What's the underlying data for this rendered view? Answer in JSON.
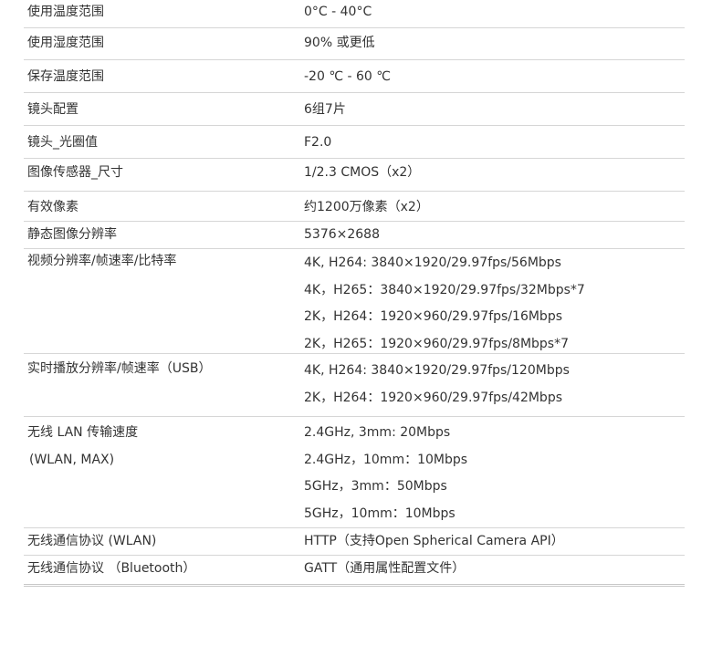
{
  "specs": [
    {
      "label": "使用温度范围",
      "values": [
        "0°C - 40°C"
      ]
    },
    {
      "label": "使用湿度范围",
      "values": [
        "90% 或更低"
      ]
    },
    {
      "label": "保存温度范围",
      "values": [
        "-20 ℃ - 60 ℃"
      ]
    },
    {
      "label": "镜头配置",
      "values": [
        "6组7片"
      ]
    },
    {
      "label": "镜头_光圈值",
      "values": [
        "F2.0"
      ]
    },
    {
      "label": "图像传感器_尺寸",
      "values": [
        "1/2.3 CMOS（x2）"
      ]
    },
    {
      "label": "有效像素",
      "values": [
        "约1200万像素（x2）"
      ]
    },
    {
      "label": "静态图像分辨率",
      "values": [
        "5376×2688"
      ]
    },
    {
      "label": "视频分辨率/帧速率/比特率",
      "values": [
        "4K, H264: 3840×1920/29.97fps/56Mbps",
        "4K，H265：3840×1920/29.97fps/32Mbps*7",
        "2K，H264：1920×960/29.97fps/16Mbps",
        "2K，H265：1920×960/29.97fps/8Mbps*7"
      ]
    },
    {
      "label": "实时播放分辨率/帧速率（USB）",
      "values": [
        "4K, H264: 3840×1920/29.97fps/120Mbps",
        "2K，H264：1920×960/29.97fps/42Mbps"
      ]
    },
    {
      "label": "无线 LAN 传输速度",
      "label2": "(WLAN, MAX)",
      "values": [
        "2.4GHz, 3mm: 20Mbps",
        "2.4GHz，10mm：10Mbps",
        "5GHz，3mm：50Mbps",
        "5GHz，10mm：10Mbps"
      ]
    },
    {
      "label": "无线通信协议 (WLAN)",
      "values": [
        "HTTP（支持Open Spherical Camera API）"
      ]
    },
    {
      "label": "无线通信协议 （Bluetooth）",
      "values": [
        "GATT（通用属性配置文件）"
      ]
    }
  ]
}
